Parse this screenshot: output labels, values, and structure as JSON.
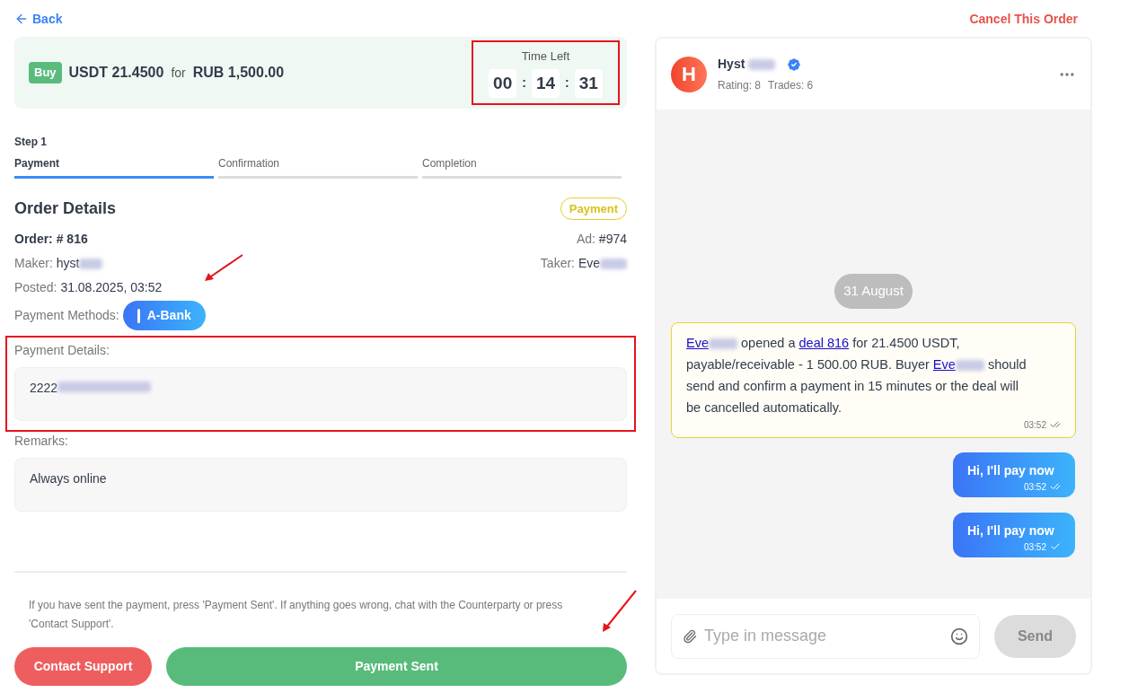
{
  "back_link": "Back",
  "cancel_link": "Cancel This Order",
  "summary": {
    "side": "Buy",
    "asset": "USDT 21.4500",
    "connector": "for",
    "fiat": "RUB 1,500.00",
    "timer": {
      "label": "Time Left",
      "parts": [
        "00",
        "14",
        "31"
      ],
      "separator": ":"
    },
    "highlighted": true
  },
  "steps": {
    "caption": "Step 1",
    "items": [
      {
        "label": "Payment",
        "selected": true
      },
      {
        "label": "Confirmation",
        "selected": false
      },
      {
        "label": "Completion",
        "selected": false
      }
    ]
  },
  "order": {
    "title": "Order Details",
    "status": "Payment",
    "number": "Order: # 816",
    "ad_label": "Ad:",
    "ad_value": "#974",
    "maker_label": "Maker:",
    "maker_value": "hyst",
    "taker_label": "Taker:",
    "taker_value": "Eve",
    "posted_label": "Posted:",
    "posted_value": "31.08.2025, 03:52",
    "methods_label": "Payment Methods:",
    "method": "A-Bank",
    "details_label": "Payment Details:",
    "details_value": "2222",
    "details_highlighted": true,
    "remarks_label": "Remarks:",
    "remarks_value": "Always online"
  },
  "help_text": "If you have sent the payment, press 'Payment Sent'. If anything goes wrong, chat with the Counterparty or press 'Contact Support'.",
  "buttons": {
    "support": "Contact Support",
    "sent": "Payment Sent"
  },
  "chat": {
    "avatar_letter": "H",
    "name": "Hyst",
    "verified": true,
    "rating": "Rating: 8",
    "trades": "Trades: 6",
    "date": "31 August",
    "system_message": {
      "parts": [
        {
          "kind": "link",
          "text": "Eve",
          "blurred": true
        },
        {
          "kind": "text",
          "text": " opened a "
        },
        {
          "kind": "link",
          "text": "deal 816",
          "blurred": false
        },
        {
          "kind": "text",
          "text": " for 21.4500 USDT, payable/receivable - 1 500.00 RUB. Buyer "
        },
        {
          "kind": "link",
          "text": "Eve",
          "blurred": true
        },
        {
          "kind": "text",
          "text": " should send and confirm a payment in 15 minutes or the deal will be cancelled automatically."
        }
      ],
      "time": "03:52",
      "read": true
    },
    "messages": [
      {
        "text": "Hi, I'll pay now",
        "time": "03:52",
        "read": true
      },
      {
        "text": "Hi, I'll pay now",
        "time": "03:52",
        "read": false
      }
    ],
    "input": {
      "placeholder": "Type in message"
    },
    "send": "Send"
  }
}
